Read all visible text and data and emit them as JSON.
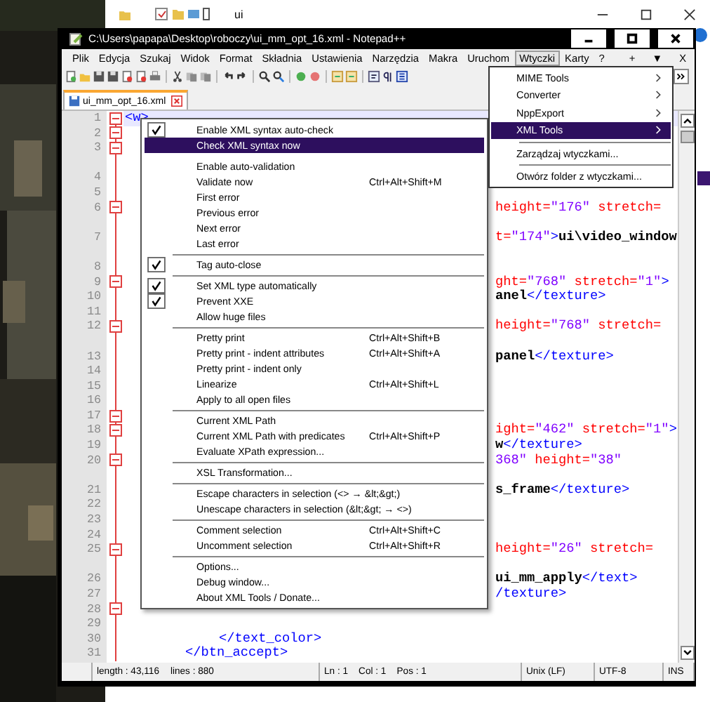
{
  "explorer": {
    "title": "ui"
  },
  "window": {
    "title": "C:\\Users\\papapa\\Desktop\\roboczy\\ui_mm_opt_16.xml - Notepad++"
  },
  "menubar": {
    "items": [
      {
        "label": "Plik",
        "selected": false
      },
      {
        "label": "Edycja",
        "selected": false
      },
      {
        "label": "Szukaj",
        "selected": false
      },
      {
        "label": "Widok",
        "selected": false
      },
      {
        "label": "Format",
        "selected": false
      },
      {
        "label": "Składnia",
        "selected": false
      },
      {
        "label": "Ustawienia",
        "selected": false
      },
      {
        "label": "Narzędzia",
        "selected": false
      },
      {
        "label": "Makra",
        "selected": false
      },
      {
        "label": "Uruchom",
        "selected": false
      },
      {
        "label": "Wtyczki",
        "selected": true
      },
      {
        "label": "Karty",
        "selected": false
      },
      {
        "label": "?",
        "selected": false
      }
    ],
    "right_controls": [
      "+",
      "▼",
      "X"
    ]
  },
  "tabs": [
    {
      "label": "ui_mm_opt_16.xml",
      "selected": true
    }
  ],
  "editor": {
    "rows": [
      {
        "number": "1",
        "fold": true,
        "current": true,
        "kind": "start",
        "code": [
          {
            "t": "<w>",
            "color": "#0000ff"
          }
        ]
      },
      {
        "number": "2",
        "fold": true,
        "current": false
      },
      {
        "number": "3",
        "fold": true,
        "current": false
      },
      {
        "current": false
      },
      {
        "number": "4",
        "fold": false,
        "current": false
      },
      {
        "number": "5",
        "fold": false,
        "current": false
      },
      {
        "number": "6",
        "fold": true,
        "current": false,
        "kind": "clipped",
        "code": [
          {
            "t": "height=",
            "color": "#ff0000"
          },
          {
            "t": "\"176\"",
            "color": "#8000ff"
          },
          {
            "t": " stretch=",
            "color": "#ff0000"
          }
        ]
      },
      {
        "current": false
      },
      {
        "number": "7",
        "fold": false,
        "current": false,
        "kind": "clipped",
        "code": [
          {
            "t": "t=",
            "color": "#ff0000"
          },
          {
            "t": "\"174\"",
            "color": "#8000ff"
          },
          {
            "t": ">",
            "color": "#0000ff"
          },
          {
            "t": "ui\\video_window",
            "color": "#000000"
          }
        ]
      },
      {
        "current": false
      },
      {
        "number": "8",
        "fold": false,
        "current": false
      },
      {
        "number": "9",
        "fold": true,
        "current": false,
        "kind": "clipped",
        "code": [
          {
            "t": "ght=",
            "color": "#ff0000"
          },
          {
            "t": "\"768\"",
            "color": "#8000ff"
          },
          {
            "t": " stretch=",
            "color": "#ff0000"
          },
          {
            "t": "\"1\"",
            "color": "#8000ff"
          },
          {
            "t": ">",
            "color": "#0000ff"
          }
        ]
      },
      {
        "number": "10",
        "fold": false,
        "current": false,
        "kind": "clipped",
        "code": [
          {
            "t": "anel",
            "color": "#000000"
          },
          {
            "t": "</texture>",
            "color": "#0000ff"
          }
        ]
      },
      {
        "number": "11",
        "fold": false,
        "current": false
      },
      {
        "number": "12",
        "fold": true,
        "current": false,
        "kind": "clipped",
        "code": [
          {
            "t": "height=",
            "color": "#ff0000"
          },
          {
            "t": "\"768\"",
            "color": "#8000ff"
          },
          {
            "t": " stretch=",
            "color": "#ff0000"
          }
        ]
      },
      {
        "current": false
      },
      {
        "number": "13",
        "fold": false,
        "current": false,
        "kind": "clipped",
        "code": [
          {
            "t": "panel",
            "color": "#000000"
          },
          {
            "t": "</texture>",
            "color": "#0000ff"
          }
        ]
      },
      {
        "number": "14",
        "fold": false,
        "current": false
      },
      {
        "number": "15",
        "fold": false,
        "current": false
      },
      {
        "number": "16",
        "fold": false,
        "current": false
      },
      {
        "number": "17",
        "fold": true,
        "current": false
      },
      {
        "number": "18",
        "fold": true,
        "current": false,
        "kind": "clipped",
        "code": [
          {
            "t": "ight=",
            "color": "#ff0000"
          },
          {
            "t": "\"462\"",
            "color": "#8000ff"
          },
          {
            "t": " stretch=",
            "color": "#ff0000"
          },
          {
            "t": "\"1\"",
            "color": "#8000ff"
          },
          {
            "t": ">",
            "color": "#0000ff"
          }
        ]
      },
      {
        "number": "19",
        "fold": false,
        "current": false,
        "kind": "clipped",
        "code": [
          {
            "t": "w",
            "color": "#000000"
          },
          {
            "t": "</texture>",
            "color": "#0000ff"
          }
        ]
      },
      {
        "number": "20",
        "fold": true,
        "current": false,
        "kind": "clipped",
        "code": [
          {
            "t": "368\"",
            "color": "#8000ff"
          },
          {
            "t": " height=",
            "color": "#ff0000"
          },
          {
            "t": "\"38\"",
            "color": "#8000ff"
          }
        ]
      },
      {
        "current": false
      },
      {
        "number": "21",
        "fold": false,
        "current": false,
        "kind": "clipped",
        "code": [
          {
            "t": "s_frame",
            "color": "#000000"
          },
          {
            "t": "</texture>",
            "color": "#0000ff"
          }
        ]
      },
      {
        "number": "22",
        "fold": false,
        "current": false
      },
      {
        "number": "23",
        "fold": false,
        "current": false
      },
      {
        "number": "24",
        "fold": false,
        "current": false
      },
      {
        "number": "25",
        "fold": true,
        "current": false,
        "kind": "clipped",
        "code": [
          {
            "t": "height=",
            "color": "#ff0000"
          },
          {
            "t": "\"26\"",
            "color": "#8000ff"
          },
          {
            "t": " stretch=",
            "color": "#ff0000"
          }
        ]
      },
      {
        "current": false
      },
      {
        "number": "26",
        "fold": false,
        "current": false,
        "kind": "clipped",
        "code": [
          {
            "t": "ui_mm_apply",
            "color": "#000000"
          },
          {
            "t": "</text>",
            "color": "#0000ff"
          }
        ]
      },
      {
        "number": "27",
        "fold": false,
        "current": false,
        "kind": "clipped",
        "code": [
          {
            "t": "/texture>",
            "color": "#0000ff"
          }
        ]
      },
      {
        "number": "28",
        "fold": true,
        "current": false
      },
      {
        "number": "29",
        "fold": false,
        "current": false
      },
      {
        "number": "30",
        "fold": false,
        "current": false,
        "kind": "deep",
        "code": [
          {
            "t": "</text_color>",
            "color": "#0000ff"
          }
        ]
      },
      {
        "number": "31",
        "fold": false,
        "current": false,
        "kind": "mid",
        "code": [
          {
            "t": "</btn_accept>",
            "color": "#0000ff"
          }
        ]
      }
    ]
  },
  "plugins_menu": {
    "items": [
      {
        "kind": "item",
        "label": "MIME Tools",
        "submenu": true,
        "selected": false
      },
      {
        "kind": "item",
        "label": "Converter",
        "submenu": true,
        "selected": false
      },
      {
        "kind": "item",
        "label": "NppExport",
        "submenu": true,
        "selected": false
      },
      {
        "kind": "item",
        "label": "XML Tools",
        "submenu": true,
        "selected": true
      },
      {
        "kind": "separator"
      },
      {
        "kind": "item",
        "label": "Zarządzaj wtyczkami...",
        "submenu": false,
        "selected": false
      },
      {
        "kind": "separator"
      },
      {
        "kind": "item",
        "label": "Otwórz folder z wtyczkami...",
        "submenu": false,
        "selected": false
      }
    ]
  },
  "xml_tools_menu": {
    "items": [
      {
        "kind": "item",
        "label": "Enable XML syntax auto-check",
        "checked": true,
        "selected": false
      },
      {
        "kind": "item",
        "label": "Check XML syntax now",
        "checked": false,
        "selected": true
      },
      {
        "kind": "gap"
      },
      {
        "kind": "item",
        "label": "Enable auto-validation",
        "checked": false,
        "selected": false
      },
      {
        "kind": "item",
        "label": "Validate now",
        "shortcut": "Ctrl+Alt+Shift+M",
        "checked": false,
        "selected": false
      },
      {
        "kind": "item",
        "label": "First error",
        "checked": false,
        "selected": false
      },
      {
        "kind": "item",
        "label": "Previous error",
        "checked": false,
        "selected": false
      },
      {
        "kind": "item",
        "label": "Next error",
        "checked": false,
        "selected": false
      },
      {
        "kind": "item",
        "label": "Last error",
        "checked": false,
        "selected": false
      },
      {
        "kind": "separator"
      },
      {
        "kind": "item",
        "label": "Tag auto-close",
        "checked": true,
        "selected": false
      },
      {
        "kind": "separator"
      },
      {
        "kind": "item",
        "label": "Set XML type automatically",
        "checked": true,
        "selected": false
      },
      {
        "kind": "item",
        "label": "Prevent XXE",
        "checked": true,
        "selected": false
      },
      {
        "kind": "item",
        "label": "Allow huge files",
        "checked": false,
        "selected": false
      },
      {
        "kind": "separator"
      },
      {
        "kind": "item",
        "label": "Pretty print",
        "shortcut": "Ctrl+Alt+Shift+B",
        "checked": false,
        "selected": false
      },
      {
        "kind": "item",
        "label": "Pretty print - indent attributes",
        "shortcut": "Ctrl+Alt+Shift+A",
        "checked": false,
        "selected": false
      },
      {
        "kind": "item",
        "label": "Pretty print - indent only",
        "checked": false,
        "selected": false
      },
      {
        "kind": "item",
        "label": "Linearize",
        "shortcut": "Ctrl+Alt+Shift+L",
        "checked": false,
        "selected": false
      },
      {
        "kind": "item",
        "label": "Apply to all open files",
        "checked": false,
        "selected": false
      },
      {
        "kind": "separator"
      },
      {
        "kind": "item",
        "label": "Current XML Path",
        "checked": false,
        "selected": false
      },
      {
        "kind": "item",
        "label": "Current XML Path with predicates",
        "shortcut": "Ctrl+Alt+Shift+P",
        "checked": false,
        "selected": false
      },
      {
        "kind": "item",
        "label": "Evaluate XPath expression...",
        "checked": false,
        "selected": false
      },
      {
        "kind": "separator"
      },
      {
        "kind": "item",
        "label": "XSL Transformation...",
        "checked": false,
        "selected": false
      },
      {
        "kind": "separator"
      },
      {
        "kind": "item",
        "label": "Escape characters in selection (<> → &lt;&gt;)",
        "checked": false,
        "selected": false
      },
      {
        "kind": "item",
        "label": "Unescape characters in selection (&lt;&gt; → <>)",
        "checked": false,
        "selected": false
      },
      {
        "kind": "separator"
      },
      {
        "kind": "item",
        "label": "Comment selection",
        "shortcut": "Ctrl+Alt+Shift+C",
        "checked": false,
        "selected": false
      },
      {
        "kind": "item",
        "label": "Uncomment selection",
        "shortcut": "Ctrl+Alt+Shift+R",
        "checked": false,
        "selected": false
      },
      {
        "kind": "separator"
      },
      {
        "kind": "item",
        "label": "Options...",
        "checked": false,
        "selected": false
      },
      {
        "kind": "item",
        "label": "Debug window...",
        "checked": false,
        "selected": false
      },
      {
        "kind": "item",
        "label": "About XML Tools / Donate...",
        "checked": false,
        "selected": false
      }
    ]
  },
  "status_bar": {
    "length": "length : 43,116",
    "lines": "lines : 880",
    "position": "Ln : 1    Col : 1    Pos : 1",
    "eol": "Unix (LF)",
    "encoding": "UTF-8",
    "mode": "INS"
  }
}
